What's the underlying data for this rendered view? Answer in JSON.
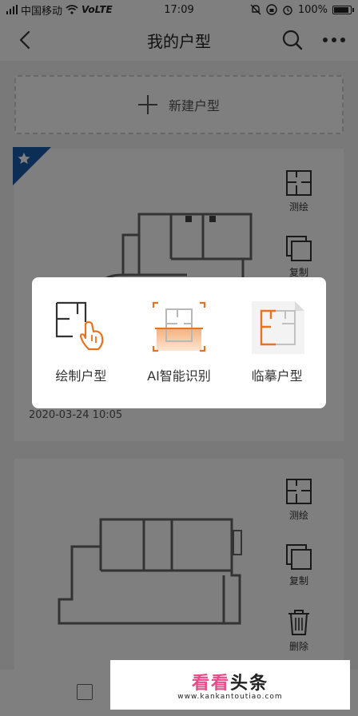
{
  "status_bar": {
    "carrier": "中国移动",
    "network": "VoLTE",
    "time": "17:09",
    "battery": "100%",
    "battery_level": 1.0
  },
  "nav": {
    "title": "我的户型",
    "icons": [
      "back-icon",
      "search-icon",
      "more-icon"
    ]
  },
  "new_plan": {
    "label": "新建户型",
    "icon": "plus-icon"
  },
  "cards": [
    {
      "starred": true,
      "name": "",
      "date": "2020-03-24 10:05",
      "actions": [
        {
          "label": "测绘",
          "icon": "measure-icon"
        },
        {
          "label": "复制",
          "icon": "copy-icon"
        }
      ]
    },
    {
      "starred": false,
      "actions": [
        {
          "label": "测绘",
          "icon": "measure-icon"
        },
        {
          "label": "复制",
          "icon": "copy-icon"
        },
        {
          "label": "删除",
          "icon": "trash-icon"
        }
      ]
    }
  ],
  "dialog": {
    "options": [
      {
        "label": "绘制户型",
        "icon": "draw-plan-icon"
      },
      {
        "label": "AI智能识别",
        "icon": "ai-scan-icon"
      },
      {
        "label": "临摹户型",
        "icon": "trace-plan-icon"
      }
    ]
  },
  "colors": {
    "accent": "#f08a4b",
    "star_badge": "#1a5da8",
    "overlay": "rgba(0,0,0,0.5)"
  },
  "watermark": {
    "text_1": "看看",
    "text_2": "头条",
    "url": "www.kankantoutiao.com"
  }
}
